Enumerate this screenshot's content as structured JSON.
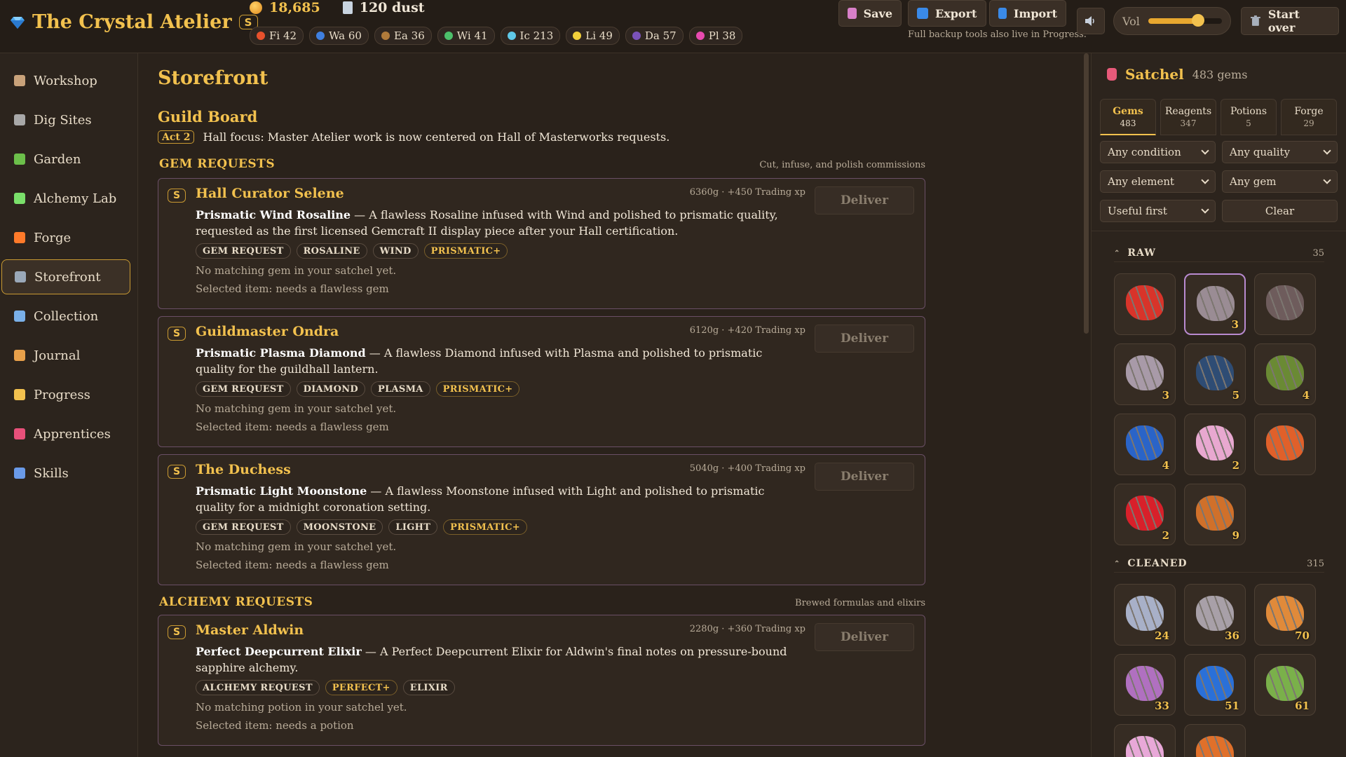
{
  "app": {
    "title": "The Crystal Atelier",
    "badge": "S",
    "gold": "18,685",
    "dust": "120 dust"
  },
  "elements": [
    {
      "label": "Fi 42",
      "color": "#e8512c"
    },
    {
      "label": "Wa 60",
      "color": "#3f7fe0"
    },
    {
      "label": "Ea 36",
      "color": "#b07a3a"
    },
    {
      "label": "Wi 41",
      "color": "#4cbf6a"
    },
    {
      "label": "Ic 213",
      "color": "#5fc8e8"
    },
    {
      "label": "Li 49",
      "color": "#f2d03a"
    },
    {
      "label": "Da 57",
      "color": "#7a52b8"
    },
    {
      "label": "Pl 38",
      "color": "#e84ab0"
    }
  ],
  "toolbar": {
    "save": "Save",
    "export": "Export",
    "import": "Import",
    "backup_note": "Full backup tools also live in Progress.",
    "vol_label": "Vol",
    "volume": 0.68,
    "start_over": "Start over"
  },
  "sidebar": {
    "items": [
      {
        "label": "Workshop",
        "icon": "hammer-icon",
        "color": "#c9a27a"
      },
      {
        "label": "Dig Sites",
        "icon": "pickaxe-icon",
        "color": "#a8a8a8"
      },
      {
        "label": "Garden",
        "icon": "leaf-icon",
        "color": "#6cbf4a"
      },
      {
        "label": "Alchemy Lab",
        "icon": "flask-icon",
        "color": "#7adf6a"
      },
      {
        "label": "Forge",
        "icon": "flame-icon",
        "color": "#ff7a2a"
      },
      {
        "label": "Storefront",
        "icon": "shop-icon",
        "color": "#9aa8b8"
      },
      {
        "label": "Collection",
        "icon": "book-icon",
        "color": "#7ab0e8"
      },
      {
        "label": "Journal",
        "icon": "journal-icon",
        "color": "#e8a04a"
      },
      {
        "label": "Progress",
        "icon": "trophy-icon",
        "color": "#f2c14e"
      },
      {
        "label": "Apprentices",
        "icon": "ticket-icon",
        "color": "#e8507a"
      },
      {
        "label": "Skills",
        "icon": "bar-chart-icon",
        "color": "#6a9ae8"
      }
    ],
    "active_index": 5
  },
  "main": {
    "page_title": "Storefront",
    "guild_title": "Guild Board",
    "act_badge": "Act 2",
    "act_text": "Hall focus: Master Atelier work is now centered on Hall of Masterworks requests.",
    "gem_section": {
      "title": "GEM REQUESTS",
      "subtitle": "Cut, infuse, and polish commissions"
    },
    "alchemy_section": {
      "title": "ALCHEMY REQUESTS",
      "subtitle": "Brewed formulas and elixirs"
    },
    "deliver_label": "Deliver",
    "requests": [
      {
        "name": "Hall Curator Selene",
        "reward": "6360g · +450 Trading xp",
        "item": "Prismatic Wind Rosaline",
        "desc": " — A flawless Rosaline infused with Wind and polished to prismatic quality, requested as the first licensed Gemcraft II display piece after your Hall certification.",
        "tags": [
          {
            "text": "GEM REQUEST",
            "gold": false
          },
          {
            "text": "ROSALINE",
            "gold": false
          },
          {
            "text": "WIND",
            "gold": false
          },
          {
            "text": "PRISMATIC+",
            "gold": true
          }
        ],
        "note1": "No matching gem in your satchel yet.",
        "note2": "Selected item: needs a flawless gem"
      },
      {
        "name": "Guildmaster Ondra",
        "reward": "6120g · +420 Trading xp",
        "item": "Prismatic Plasma Diamond",
        "desc": " — A flawless Diamond infused with Plasma and polished to prismatic quality for the guildhall lantern.",
        "tags": [
          {
            "text": "GEM REQUEST",
            "gold": false
          },
          {
            "text": "DIAMOND",
            "gold": false
          },
          {
            "text": "PLASMA",
            "gold": false
          },
          {
            "text": "PRISMATIC+",
            "gold": true
          }
        ],
        "note1": "No matching gem in your satchel yet.",
        "note2": "Selected item: needs a flawless gem"
      },
      {
        "name": "The Duchess",
        "reward": "5040g · +400 Trading xp",
        "item": "Prismatic Light Moonstone",
        "desc": " — A flawless Moonstone infused with Light and polished to prismatic quality for a midnight coronation setting.",
        "tags": [
          {
            "text": "GEM REQUEST",
            "gold": false
          },
          {
            "text": "MOONSTONE",
            "gold": false
          },
          {
            "text": "LIGHT",
            "gold": false
          },
          {
            "text": "PRISMATIC+",
            "gold": true
          }
        ],
        "note1": "No matching gem in your satchel yet.",
        "note2": "Selected item: needs a flawless gem"
      },
      {
        "name": "Master Aldwin",
        "reward": "2280g · +360 Trading xp",
        "item": "Perfect Deepcurrent Elixir",
        "desc": " — A Perfect Deepcurrent Elixir for Aldwin's final notes on pressure-bound sapphire alchemy.",
        "tags": [
          {
            "text": "ALCHEMY REQUEST",
            "gold": false
          },
          {
            "text": "PERFECT+",
            "gold": true
          },
          {
            "text": "ELIXIR",
            "gold": false
          }
        ],
        "note1": "No matching potion in your satchel yet.",
        "note2": "Selected item: needs a potion"
      }
    ]
  },
  "satchel": {
    "title": "Satchel",
    "count": "483 gems",
    "tabs": [
      {
        "label": "Gems",
        "count": "483"
      },
      {
        "label": "Reagents",
        "count": "347"
      },
      {
        "label": "Potions",
        "count": "5"
      },
      {
        "label": "Forge",
        "count": "29"
      }
    ],
    "filters": {
      "condition": "Any condition",
      "quality": "Any quality",
      "element": "Any element",
      "gem": "Any gem",
      "sort": "Useful first",
      "clear": "Clear"
    },
    "raw": {
      "title": "RAW",
      "count": "35",
      "gems": [
        {
          "color": "#d8342a",
          "qty": ""
        },
        {
          "color": "#9a8c94",
          "qty": "3",
          "selected": true
        },
        {
          "color": "#6e5c5c",
          "qty": ""
        },
        {
          "color": "#a89aa8",
          "qty": "3"
        },
        {
          "color": "#2e4c74",
          "qty": "5"
        },
        {
          "color": "#6a8a34",
          "qty": "4"
        },
        {
          "color": "#2a64c8",
          "qty": "4"
        },
        {
          "color": "#e8a8d0",
          "qty": "2"
        },
        {
          "color": "#e0602a",
          "qty": ""
        },
        {
          "color": "#d8202a",
          "qty": "2"
        },
        {
          "color": "#d0702a",
          "qty": "9"
        }
      ]
    },
    "cleaned": {
      "title": "CLEANED",
      "count": "315",
      "gems": [
        {
          "color": "#a8b0c8",
          "qty": "24"
        },
        {
          "color": "#a8a0a8",
          "qty": "36"
        },
        {
          "color": "#e08a3a",
          "qty": "70"
        },
        {
          "color": "#b070c0",
          "qty": "33"
        },
        {
          "color": "#2a70d8",
          "qty": "51"
        },
        {
          "color": "#7ab04a",
          "qty": "61"
        },
        {
          "color": "#e8a8d8",
          "qty": ""
        },
        {
          "color": "#e0702a",
          "qty": ""
        }
      ]
    }
  }
}
